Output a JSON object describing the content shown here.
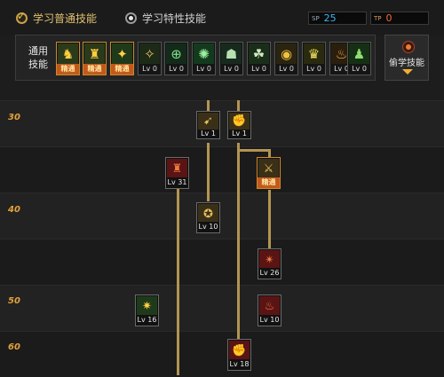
{
  "tabs": {
    "normal": "学习普通技能",
    "special": "学习特性技能"
  },
  "counters": {
    "sp": {
      "icon": "SP",
      "value": "25"
    },
    "tp": {
      "icon": "TP",
      "value": "0"
    }
  },
  "general": {
    "title_line1": "通用",
    "title_line2": "技能",
    "skills": [
      {
        "tag": "精通",
        "icon": "sitting-figure-icon",
        "master": true
      },
      {
        "tag": "精通",
        "icon": "leaping-figure-icon",
        "master": true
      },
      {
        "tag": "精通",
        "icon": "kick-figure-icon",
        "master": true
      },
      {
        "tag": "Lv 0",
        "icon": "wing-emblem-icon",
        "master": false
      },
      {
        "tag": "Lv 0",
        "icon": "crosshair-icon",
        "master": false
      },
      {
        "tag": "Lv 0",
        "icon": "radiant-crosshair-icon",
        "master": false
      },
      {
        "tag": "Lv 0",
        "icon": "sprint-figure-icon",
        "master": false
      },
      {
        "tag": "Lv 0",
        "icon": "rising-figure-icon",
        "master": false
      },
      {
        "tag": "Lv 0",
        "icon": "target-eye-icon",
        "master": false
      },
      {
        "tag": "Lv 0",
        "icon": "power-figure-icon",
        "master": false
      },
      {
        "tag": "Lv 0",
        "icon": "flame-figure-icon",
        "master": false
      },
      {
        "tag": "Lv 0",
        "icon": "green-figure-icon",
        "master": false
      }
    ]
  },
  "steal": {
    "label": "偷学技能",
    "icon": "orb-icon"
  },
  "levels": [
    "30",
    "40",
    "50",
    "60"
  ],
  "tree_nodes": [
    {
      "tag": "Lv 1",
      "icon": "slash-icon",
      "color": "gold"
    },
    {
      "tag": "Lv 1",
      "icon": "fist-icon",
      "color": "gold"
    },
    {
      "tag": "Lv 31",
      "icon": "red-pillar-icon",
      "color": "red"
    },
    {
      "tag": "精通",
      "icon": "crossed-blades-icon",
      "color": "gold",
      "master": true
    },
    {
      "tag": "Lv 10",
      "icon": "whirl-strike-icon",
      "color": "gold"
    },
    {
      "tag": "Lv 26",
      "icon": "red-claw-icon",
      "color": "red"
    },
    {
      "tag": "Lv 16",
      "icon": "green-burst-icon",
      "color": "green"
    },
    {
      "tag": "Lv 10",
      "icon": "red-fire-icon",
      "color": "red"
    },
    {
      "tag": "Lv 18",
      "icon": "red-fist-icon",
      "color": "red"
    }
  ]
}
